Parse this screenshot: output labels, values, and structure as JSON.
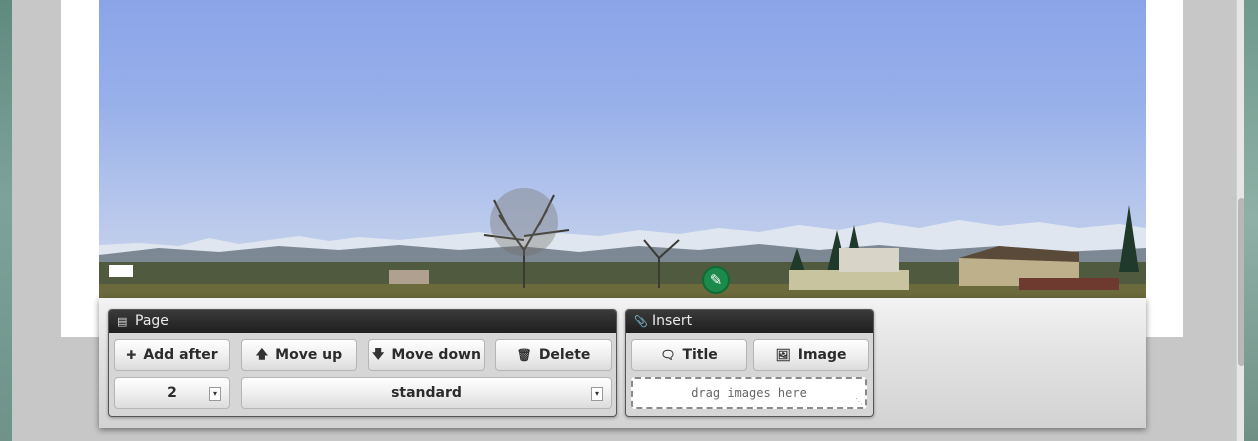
{
  "page_panel": {
    "title": "Page",
    "add_after_label": "Add after",
    "move_up_label": "Move up",
    "move_down_label": "Move down",
    "delete_label": "Delete",
    "page_number": "2",
    "layout_value": "standard"
  },
  "insert_panel": {
    "title": "Insert",
    "title_label": "Title",
    "image_label": "Image",
    "dropzone_text": "drag images here"
  },
  "icons": {
    "page_panel": "document-icon",
    "insert_panel": "paperclip-icon",
    "add_after": "plus-icon",
    "move_up": "arrow-up-icon",
    "move_down": "arrow-down-icon",
    "delete": "trash-icon",
    "title": "speech-bubble-icon",
    "image": "image-icon",
    "edit": "pencil-icon"
  },
  "colors": {
    "edit_badge": "#1c8a4a",
    "panel_header": "#2a2a2a"
  }
}
